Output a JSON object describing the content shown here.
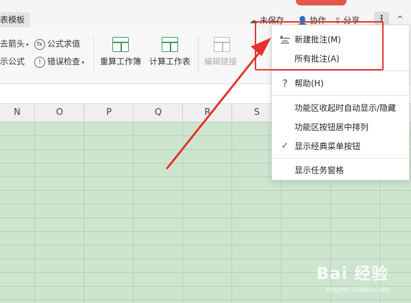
{
  "toolbar_top": {
    "tab_label": "表模板",
    "unsaved": "未保存",
    "collaborate": "协作",
    "share": "分享",
    "more_icon": "⋮",
    "collapse_icon": "^"
  },
  "ribbon": {
    "trace_arrow": "去箭头",
    "formula_eval": "公式求值",
    "show_formula": "示公式",
    "error_check": "错误检查",
    "recalc_workbook": "重算工作簿",
    "calc_sheet": "计算工作表",
    "edit_links": "编辑链接"
  },
  "columns": [
    "N",
    "O",
    "P",
    "Q",
    "R",
    "S"
  ],
  "menu": {
    "new_comment": "新建批注(M)",
    "all_comments": "所有批注(A)",
    "help": "帮助(H)",
    "auto_show_hide": "功能区收起时自动显示/隐藏",
    "center_buttons": "功能区按钮居中排列",
    "classic_menu": "显示经典菜单按钮",
    "task_pane": "显示任务窗格"
  },
  "watermark": {
    "brand": "Bai 经验",
    "site": "jingyan.baidu.com"
  },
  "colors": {
    "grid_green": "#cde5cf",
    "annotation_red": "#e8302a"
  }
}
